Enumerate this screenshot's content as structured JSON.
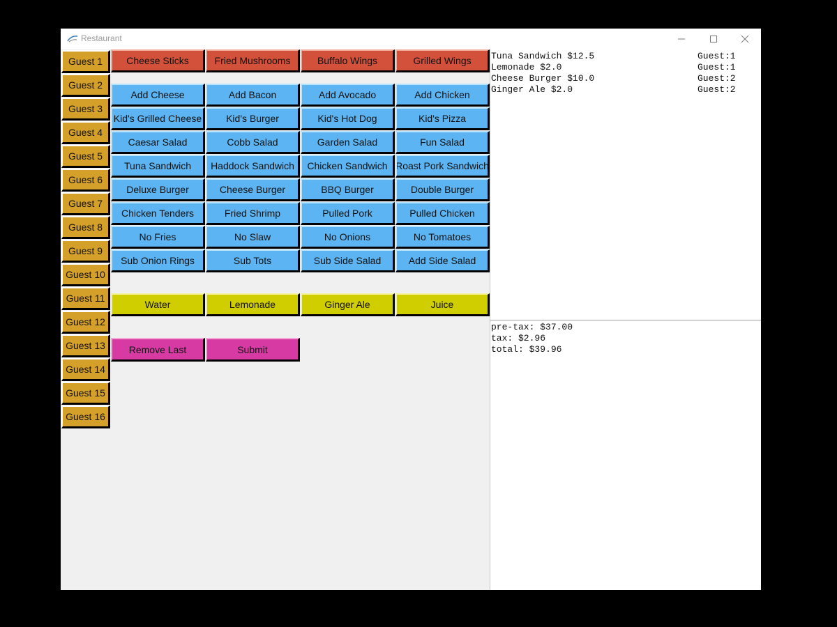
{
  "window": {
    "title": "Restaurant"
  },
  "guests": [
    "Guest 1",
    "Guest 2",
    "Guest 3",
    "Guest 4",
    "Guest 5",
    "Guest 6",
    "Guest 7",
    "Guest 8",
    "Guest 9",
    "Guest 10",
    "Guest 11",
    "Guest 12",
    "Guest 13",
    "Guest 14",
    "Guest 15",
    "Guest 16"
  ],
  "appetizers": [
    "Cheese Sticks",
    "Fried Mushrooms",
    "Buffalo Wings",
    "Grilled Wings"
  ],
  "menu_rows": [
    [
      "Add Cheese",
      "Add Bacon",
      "Add Avocado",
      "Add Chicken"
    ],
    [
      "Kid's Grilled Cheese",
      "Kid's Burger",
      "Kid's Hot Dog",
      "Kid's Pizza"
    ],
    [
      "Caesar Salad",
      "Cobb Salad",
      "Garden Salad",
      "Fun Salad"
    ],
    [
      "Tuna Sandwich",
      "Haddock Sandwich",
      "Chicken Sandwich",
      "Roast Pork Sandwich"
    ],
    [
      "Deluxe Burger",
      "Cheese Burger",
      "BBQ Burger",
      "Double Burger"
    ],
    [
      "Chicken Tenders",
      "Fried Shrimp",
      "Pulled Pork",
      "Pulled Chicken"
    ],
    [
      "No Fries",
      "No Slaw",
      "No Onions",
      "No Tomatoes"
    ],
    [
      "Sub Onion Rings",
      "Sub Tots",
      "Sub Side Salad",
      "Add Side Salad"
    ]
  ],
  "drinks": [
    "Water",
    "Lemonade",
    "Ginger Ale",
    "Juice"
  ],
  "actions": {
    "remove_last": "Remove Last",
    "submit": "Submit"
  },
  "order_items": [
    {
      "item": "Tuna Sandwich $12.5",
      "guest": "Guest:1"
    },
    {
      "item": "Lemonade $2.0",
      "guest": "Guest:1"
    },
    {
      "item": "Cheese Burger $10.0",
      "guest": "Guest:2"
    },
    {
      "item": "Ginger Ale $2.0",
      "guest": "Guest:2"
    }
  ],
  "totals": {
    "pretax": "pre-tax: $37.00",
    "tax": "tax: $2.96",
    "total": "total: $39.96"
  },
  "colors": {
    "guest": "#d4a02a",
    "appetizer": "#d3513b",
    "menu": "#5cb4f2",
    "drink": "#d0cd00",
    "action": "#d83aa4"
  }
}
